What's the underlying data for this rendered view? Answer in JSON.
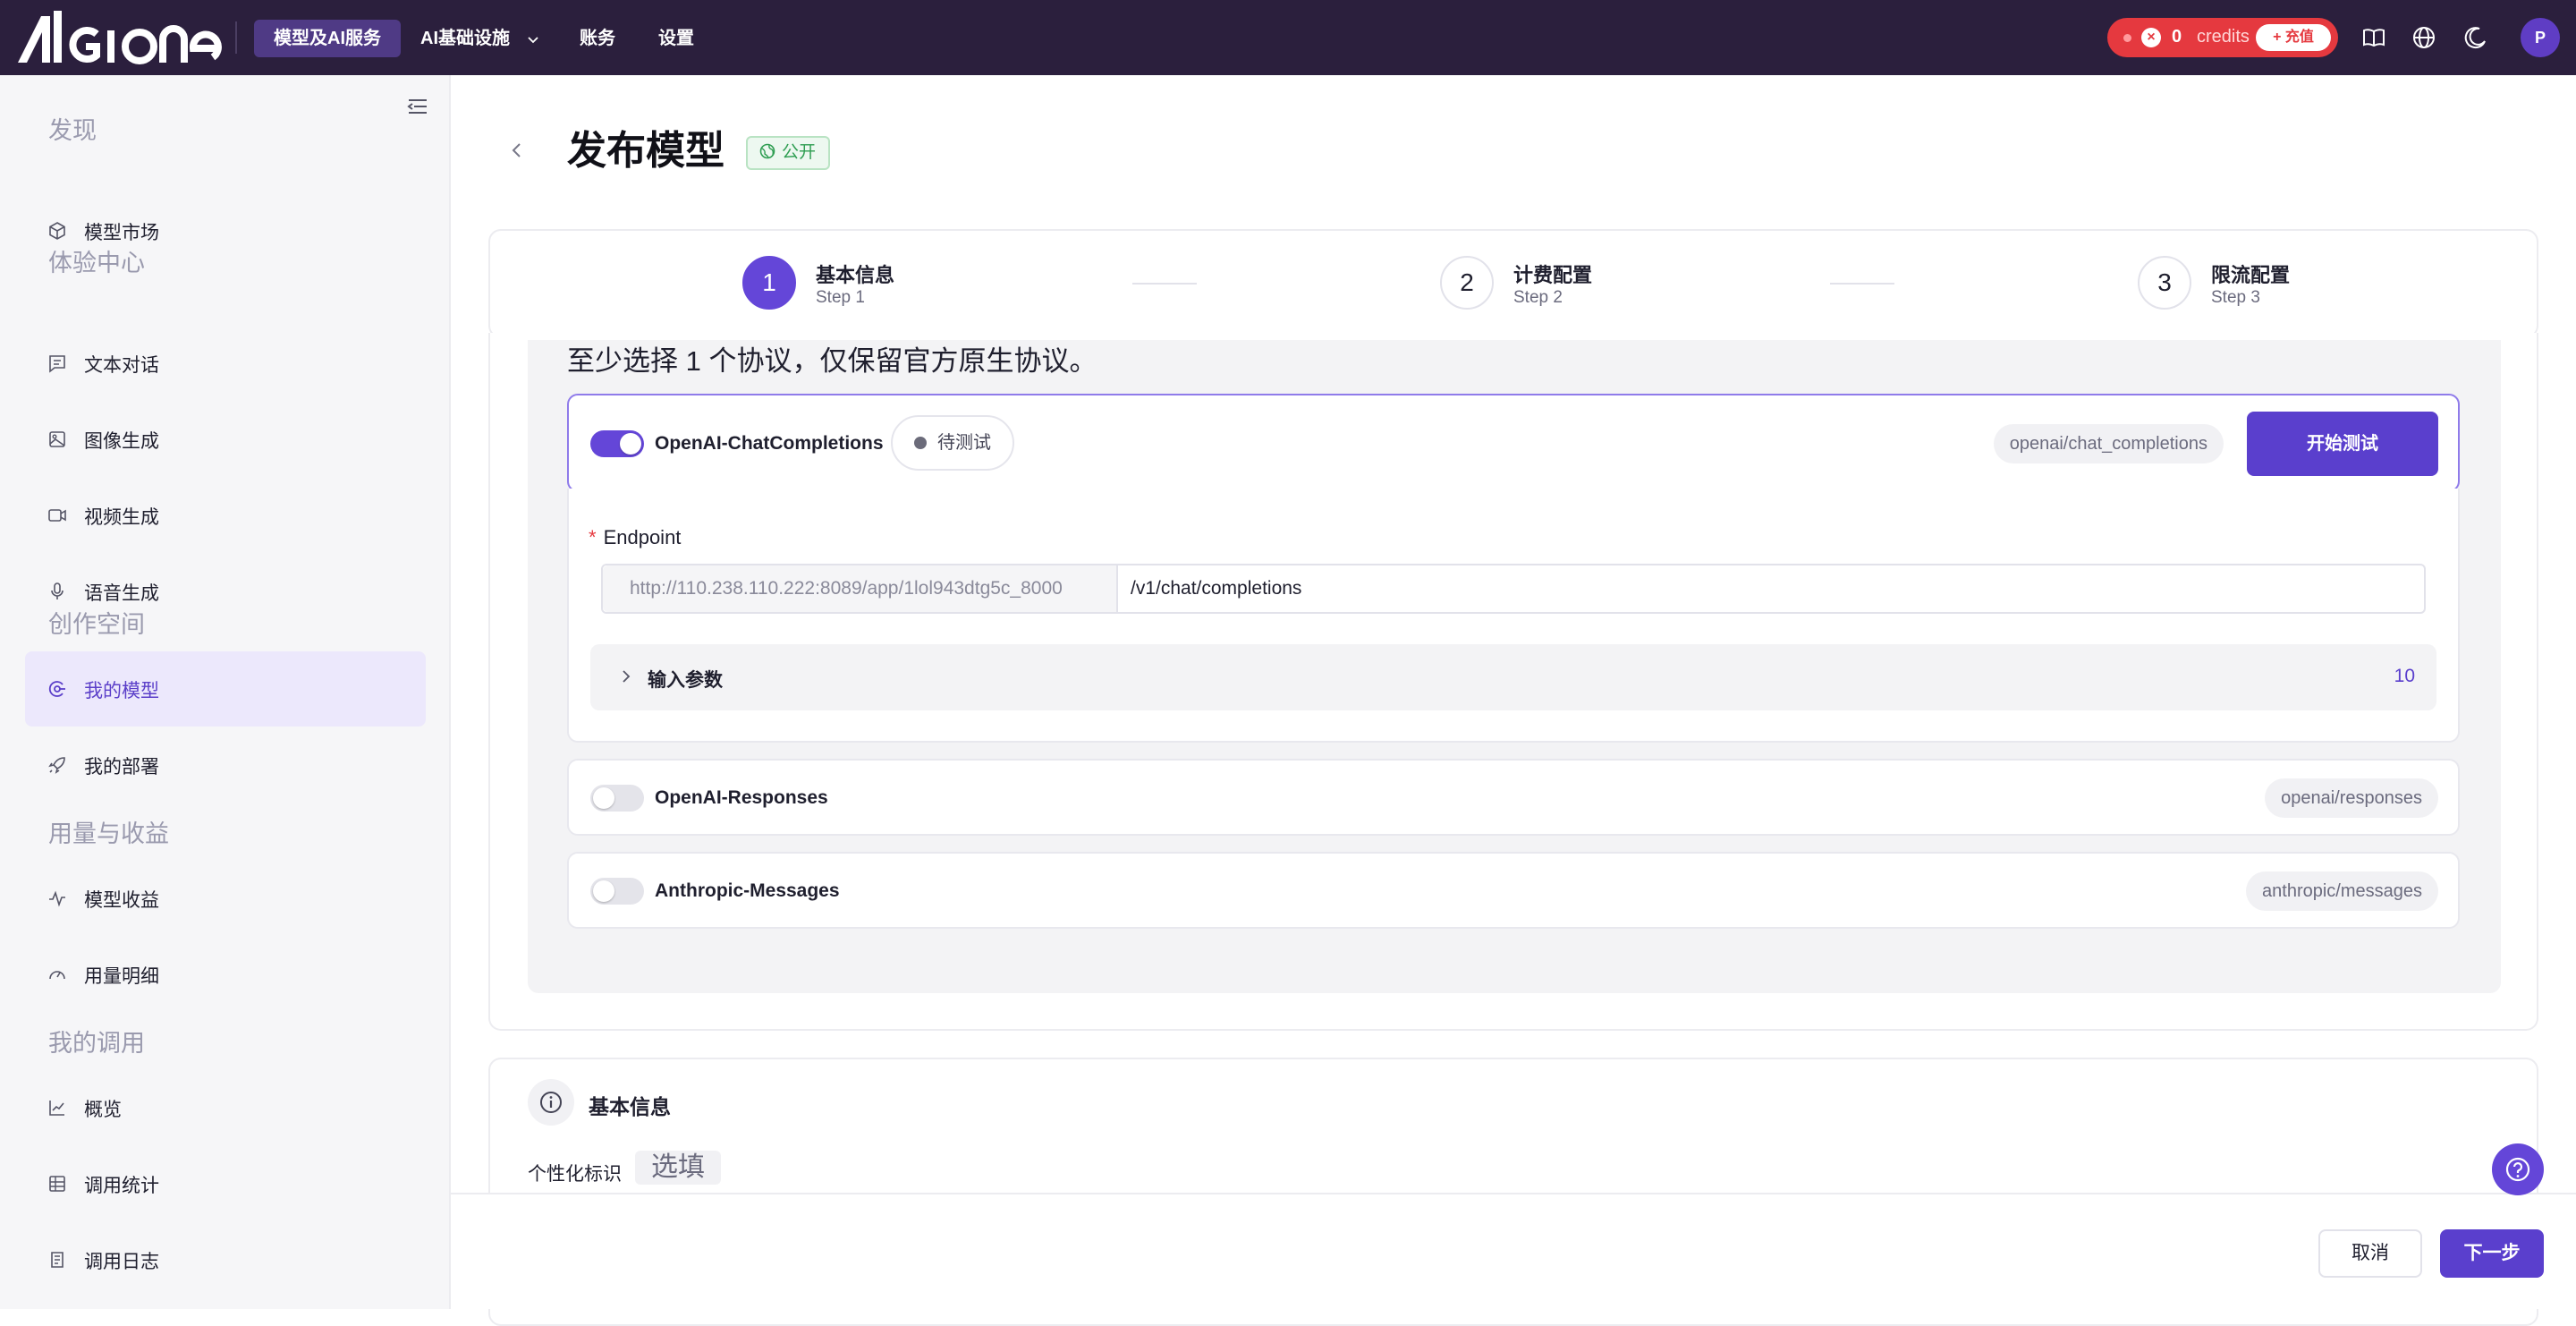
{
  "brand": {
    "name": "AIGIONE",
    "accent": "#5a3fcd",
    "topbar_bg": "#2b1f3d"
  },
  "topnav": {
    "items": [
      {
        "label": "模型及AI服务",
        "active": true
      },
      {
        "label": "AI基础设施",
        "has_dropdown": true
      },
      {
        "label": "账务"
      },
      {
        "label": "设置"
      }
    ]
  },
  "credits": {
    "value": "0",
    "label": "credits",
    "recharge": "+ 充值"
  },
  "top_icons": [
    "book-icon",
    "globe-icon",
    "moon-icon"
  ],
  "user": {
    "avatar_initial": "P"
  },
  "sidebar": {
    "sections": [
      {
        "label": "发现",
        "items": [
          {
            "label": "模型市场",
            "icon": "cube-icon"
          }
        ]
      },
      {
        "label": "体验中心",
        "items": [
          {
            "label": "文本对话",
            "icon": "chat-icon"
          },
          {
            "label": "图像生成",
            "icon": "image-icon"
          },
          {
            "label": "视频生成",
            "icon": "video-icon"
          },
          {
            "label": "语音生成",
            "icon": "mic-icon"
          }
        ]
      },
      {
        "label": "创作空间",
        "items": [
          {
            "label": "我的模型",
            "icon": "model-icon",
            "active": true
          },
          {
            "label": "我的部署",
            "icon": "rocket-icon"
          }
        ]
      },
      {
        "label": "用量与收益",
        "items": [
          {
            "label": "模型收益",
            "icon": "pulse-icon"
          },
          {
            "label": "用量明细",
            "icon": "gauge-icon"
          }
        ]
      },
      {
        "label": "我的调用",
        "items": [
          {
            "label": "概览",
            "icon": "line-chart-icon"
          },
          {
            "label": "调用统计",
            "icon": "table-icon"
          },
          {
            "label": "调用日志",
            "icon": "log-icon"
          }
        ]
      }
    ]
  },
  "page": {
    "title": "发布模型",
    "badge": "公开"
  },
  "steps": [
    {
      "num": "1",
      "title": "基本信息",
      "sub": "Step 1",
      "active": true
    },
    {
      "num": "2",
      "title": "计费配置",
      "sub": "Step 2"
    },
    {
      "num": "3",
      "title": "限流配置",
      "sub": "Step 3"
    }
  ],
  "protocols": {
    "hint": "至少选择 1 个协议，仅保留官方原生协议。",
    "items": [
      {
        "name": "OpenAI-ChatCompletions",
        "enabled": true,
        "status": "待测试",
        "path": "openai/chat_completions",
        "action": "开始测试"
      },
      {
        "name": "OpenAI-Responses",
        "enabled": false,
        "path": "openai/responses"
      },
      {
        "name": "Anthropic-Messages",
        "enabled": false,
        "path": "anthropic/messages"
      }
    ],
    "endpoint": {
      "label": "Endpoint",
      "prefix": "http://110.238.110.222:8089/app/1lol943dtg5c_8000",
      "path": "/v1/chat/completions"
    },
    "input_params": {
      "label": "输入参数",
      "count": "10"
    }
  },
  "basic_info": {
    "title": "基本信息",
    "ident_label": "个性化标识",
    "ident_placeholder": "选填"
  },
  "footer": {
    "cancel": "取消",
    "next": "下一步"
  }
}
